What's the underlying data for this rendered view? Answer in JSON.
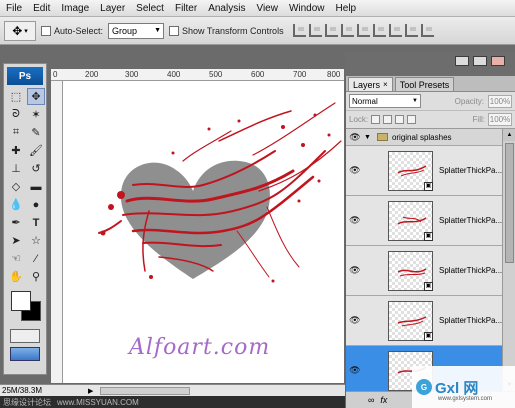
{
  "menu": [
    "File",
    "Edit",
    "Image",
    "Layer",
    "Select",
    "Filter",
    "Analysis",
    "View",
    "Window",
    "Help"
  ],
  "options": {
    "auto_select_label": "Auto-Select:",
    "auto_select_value": "Group",
    "show_transform_label": "Show Transform Controls"
  },
  "toolbox": {
    "logo": "Ps",
    "tools": [
      "marquee-icon",
      "move-icon",
      "lasso-icon",
      "magic-wand-icon",
      "crop-icon",
      "eyedropper-icon",
      "healing-icon",
      "brush-icon",
      "stamp-icon",
      "history-brush-icon",
      "eraser-icon",
      "gradient-icon",
      "blur-icon",
      "dodge-icon",
      "pen-icon",
      "type-icon",
      "path-select-icon",
      "shape-icon",
      "hand-3d-icon",
      "eyedropper2-icon",
      "hand-icon",
      "zoom-icon"
    ]
  },
  "ruler": {
    "ticks": [
      "0",
      "200",
      "300",
      "400",
      "500",
      "600",
      "700",
      "800"
    ]
  },
  "document": {
    "watermark": "Alfoart.com"
  },
  "status": {
    "doc_size": "25M/38.3M"
  },
  "footer_watermark": {
    "left": "思缘设计论坛",
    "right": "www.MISSYUAN.COM"
  },
  "layers_panel": {
    "tabs": [
      {
        "label": "Layers",
        "close": "×"
      },
      {
        "label": "Tool Presets"
      }
    ],
    "blend_mode": "Normal",
    "opacity_label": "Opacity:",
    "opacity_value": "100%",
    "lock_label": "Lock:",
    "fill_label": "Fill:",
    "fill_value": "100%",
    "group": {
      "name": "original splashes"
    },
    "layers": [
      {
        "name": "SplatterThickPa...",
        "selected": false
      },
      {
        "name": "SplatterThickPa...",
        "selected": false
      },
      {
        "name": "SplatterThickPa...",
        "selected": false
      },
      {
        "name": "SplatterThickPa...",
        "selected": false
      },
      {
        "name": "",
        "selected": true
      }
    ],
    "footer_icons": [
      "link-icon",
      "fx-icon"
    ],
    "footer_fx": "fx"
  },
  "site_badge": {
    "brand": "Gxl 网",
    "url": "www.gxlsystem.com"
  },
  "colors": {
    "accent": "#3a8ee6",
    "splatter": "#c0141e",
    "heart": "#8f8f8f",
    "watermark": "#a56ac9"
  }
}
